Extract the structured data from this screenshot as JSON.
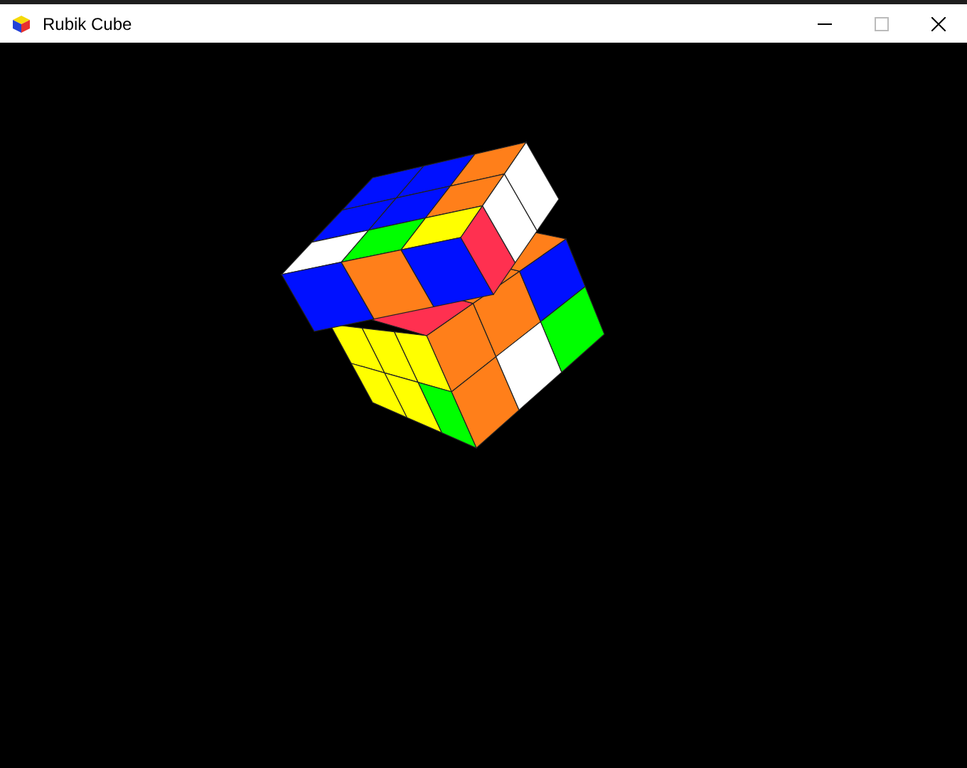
{
  "window": {
    "title": "Rubik Cube"
  }
}
